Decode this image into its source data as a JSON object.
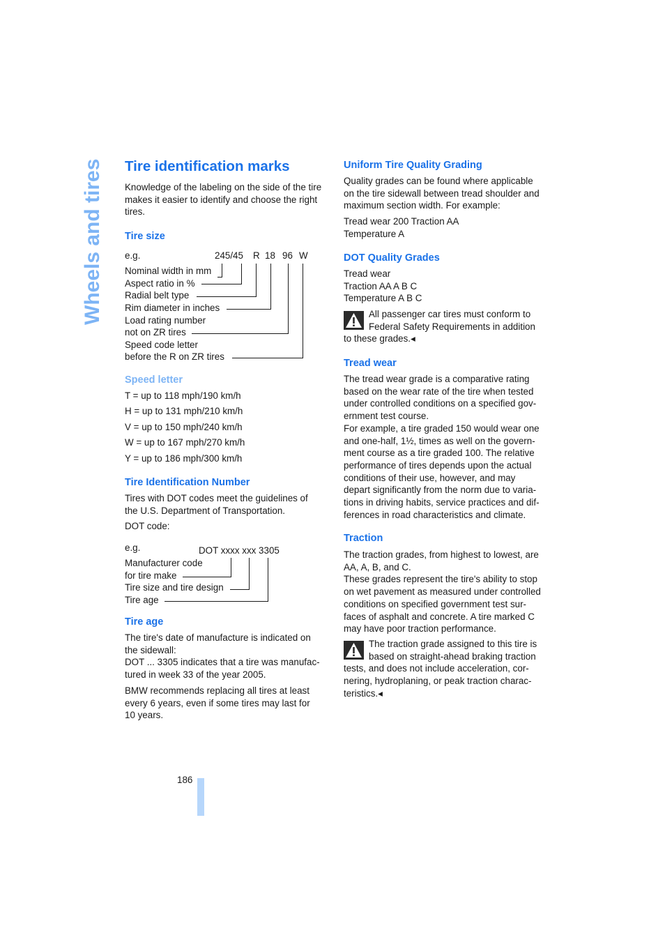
{
  "side_tab": "Wheels and tires",
  "page_number": "186",
  "left": {
    "title": "Tire identification marks",
    "intro": [
      "Knowledge of the labeling on the side of the tire",
      "makes it easier to identify and choose the right",
      "tires."
    ],
    "tire_size": {
      "heading": "Tire size",
      "eg": "e.g.",
      "code_parts": [
        "245/45",
        "R",
        "18",
        "96",
        "W"
      ],
      "labels": [
        "Nominal width in mm",
        "Aspect ratio in %",
        "Radial belt type",
        "Rim diameter in inches",
        "Load rating number",
        "not on ZR tires",
        "Speed code letter",
        "before the R on ZR tires"
      ]
    },
    "speed_letter": {
      "heading": "Speed letter",
      "items": [
        "T = up to 118 mph/190 km/h",
        "H = up to 131 mph/210 km/h",
        "V = up to 150 mph/240 km/h",
        "W = up to 167 mph/270 km/h",
        "Y = up to 186 mph/300 km/h"
      ]
    },
    "tin": {
      "heading": "Tire Identification Number",
      "text": [
        "Tires with DOT codes meet the guidelines of",
        "the U.S. Department of Transportation."
      ],
      "dot_label": "DOT code:",
      "eg": "e.g.",
      "code": "DOT xxxx xxx 3305",
      "labels": [
        "Manufacturer code",
        "for tire make",
        "Tire size and tire design",
        "Tire age"
      ]
    },
    "tire_age": {
      "heading": "Tire age",
      "p1": [
        "The tire's date of manufacture is indicated on",
        "the sidewall:",
        "DOT ... 3305 indicates that a tire was manufac-",
        "tured in week 33 of the year 2005."
      ],
      "p2": [
        "BMW recommends replacing all tires at least",
        "every 6 years, even if some tires may last for",
        "10 years."
      ]
    }
  },
  "right": {
    "utqg": {
      "heading": "Uniform Tire Quality Grading",
      "text": [
        "Quality grades can be found where applicable",
        "on the tire sidewall between tread shoulder and",
        "maximum section width. For example:"
      ],
      "example": [
        "Tread wear 200 Traction AA",
        "Temperature A"
      ]
    },
    "dot_grades": {
      "heading": "DOT Quality Grades",
      "items": [
        "Tread wear",
        "Traction AA A B C",
        "Temperature A B C"
      ],
      "warning": [
        "All passenger car tires must conform to",
        "Federal Safety Requirements in addition",
        "to these grades.◂"
      ],
      "warning_icon": "warning-triangle-icon"
    },
    "tread_wear": {
      "heading": "Tread wear",
      "text": [
        "The tread wear grade is a comparative rating",
        "based on the wear rate of the tire when tested",
        "under controlled conditions on a specified gov-",
        "ernment test course.",
        "For example, a tire graded 150 would wear one",
        "and one-half, 1½, times as well on the govern-",
        "ment course as a tire graded 100. The relative",
        "performance of tires depends upon the actual",
        "conditions of their use, however, and may",
        "depart significantly from the norm due to varia-",
        "tions in driving habits, service practices and dif-",
        "ferences in road characteristics and climate."
      ]
    },
    "traction": {
      "heading": "Traction",
      "text": [
        "The traction grades, from highest to lowest, are",
        "AA, A, B, and C.",
        "These grades represent the tire's ability to stop",
        "on wet pavement as measured under controlled",
        "conditions on specified government test sur-",
        "faces of asphalt and concrete. A tire marked C",
        "may have poor traction performance."
      ],
      "warning": [
        "The traction grade assigned to this tire is",
        "based on straight-ahead braking traction",
        "tests, and does not include acceleration, cor-",
        "nering, hydroplaning, or peak traction charac-",
        "teristics.◂"
      ],
      "warning_icon": "warning-triangle-icon"
    }
  },
  "colors": {
    "heading": "#1b72e8",
    "heading_light": "#7db4f5",
    "side_tab": "#7db4f5",
    "page_bar": "#b6d6fb"
  }
}
